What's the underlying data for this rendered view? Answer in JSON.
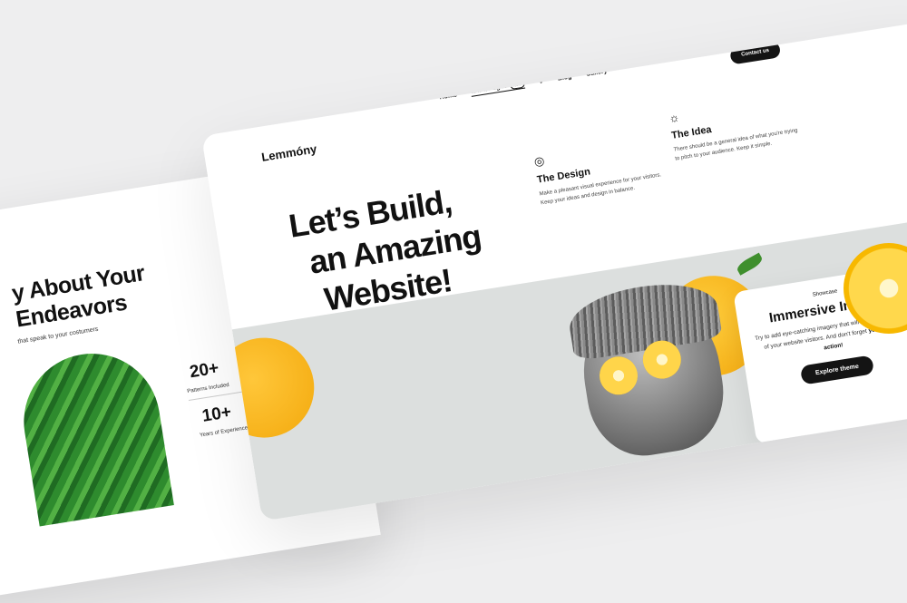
{
  "back": {
    "title": "y About Your\nEndeavors",
    "subtitle": "that speak to your costumers",
    "stat1_num": "20+",
    "stat1_label": "Patterns Included",
    "stat2_num": "10+",
    "stat2_label": "Years of Experience"
  },
  "header": {
    "logo": "Lemmóny",
    "nav": {
      "home": "Home",
      "extra": "Extra Pages",
      "extra_badge": "New",
      "blog": "Blog",
      "gallery": "Gallery"
    },
    "contact": "Contact us"
  },
  "hero": {
    "line1": "Let’s Build,",
    "line2": "an Amazing",
    "line3": "Website!"
  },
  "features": [
    {
      "title": "The Design",
      "desc": "Make a pleasant visual experience for your visitors. Keep your ideas and design in balance.",
      "icon": "eye-icon"
    },
    {
      "title": "The Idea",
      "desc": "There should be a general idea of what you're trying to pitch to your audience. Keep it simple.",
      "icon": "sun-icon"
    }
  ],
  "showcase": {
    "label": "Showcase",
    "title": "Immersive Images",
    "desc_plain": "Try to add eye-catching imagery that will grab the attention of your website visitors. And don't forget",
    "desc_bold": "your call to action!",
    "button": "Explore theme"
  },
  "colors": {
    "accent": "#141414",
    "lemon": "#f7b500",
    "band": "#dcdfde"
  }
}
